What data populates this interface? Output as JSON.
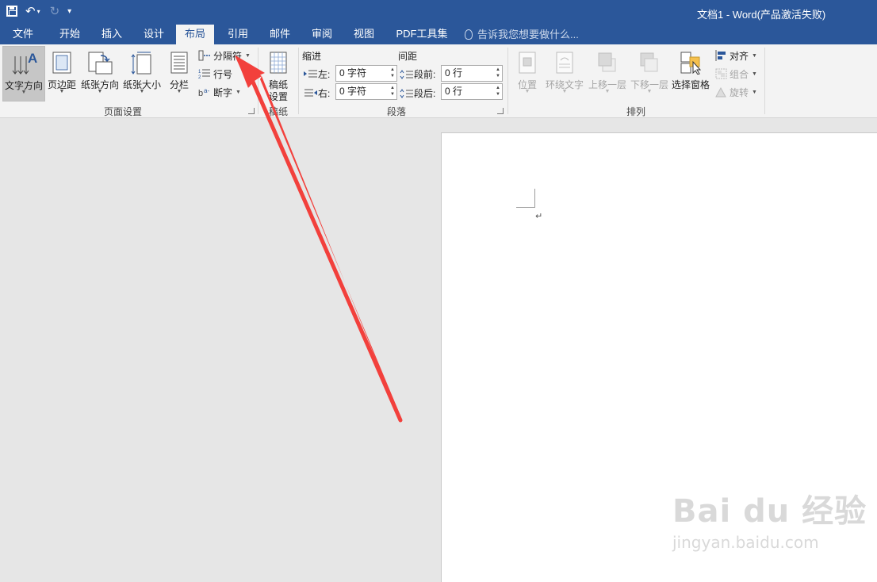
{
  "titlebar": {
    "doc_title": "文档1 - Word(产品激活失败)",
    "undo_icon": "undo-icon",
    "redo_icon": "redo-icon",
    "save_icon": "save-icon",
    "customize_icon": "customize-qat-icon"
  },
  "tabs": [
    {
      "label": "文件"
    },
    {
      "label": "开始"
    },
    {
      "label": "插入"
    },
    {
      "label": "设计"
    },
    {
      "label": "布局",
      "active": true
    },
    {
      "label": "引用"
    },
    {
      "label": "邮件"
    },
    {
      "label": "审阅"
    },
    {
      "label": "视图"
    },
    {
      "label": "PDF工具集"
    }
  ],
  "tell_me": {
    "placeholder": "告诉我您想要做什么..."
  },
  "ribbon": {
    "page_setup": {
      "group_label": "页面设置",
      "text_direction": "文字方向",
      "margins": "页边距",
      "orientation": "纸张方向",
      "size": "纸张大小",
      "columns": "分栏",
      "breaks": "分隔符",
      "line_numbers": "行号",
      "hyphenation": "断字"
    },
    "manuscript": {
      "group_label": "稿纸",
      "settings_line1": "稿纸",
      "settings_line2": "设置"
    },
    "paragraph": {
      "group_label": "段落",
      "indent_title": "缩进",
      "spacing_title": "间距",
      "left_label": "左:",
      "left_value": "0 字符",
      "right_label": "右:",
      "right_value": "0 字符",
      "before_label": "段前:",
      "before_value": "0 行",
      "after_label": "段后:",
      "after_value": "0 行"
    },
    "arrange": {
      "group_label": "排列",
      "position": "位置",
      "wrap_text": "环绕文字",
      "bring_forward": "上移一层",
      "send_backward": "下移一层",
      "selection_pane": "选择窗格",
      "align": "对齐",
      "group": "组合",
      "rotate": "旋转"
    }
  },
  "document": {
    "paragraph_mark": "↵"
  },
  "watermark": {
    "main": "Bai du 经验",
    "sub": "jingyan.baidu.com"
  },
  "colors": {
    "title_bar": "#2b579a",
    "ribbon_bg": "#f3f3f3",
    "canvas_bg": "#e6e6e6",
    "annotation_arrow": "#f2403c"
  }
}
